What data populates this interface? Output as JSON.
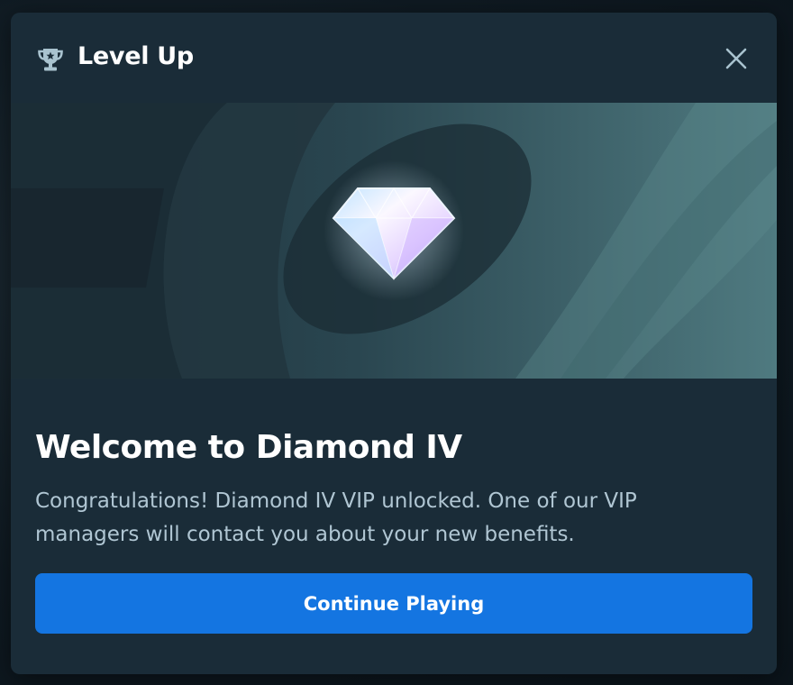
{
  "modal": {
    "title": "Level Up",
    "heading": "Welcome to Diamond IV",
    "message": "Congratulations! Diamond IV VIP unlocked. One of our VIP managers will contact you about your new benefits.",
    "cta_label": "Continue Playing"
  },
  "icons": {
    "header": "trophy-icon",
    "close": "close-icon",
    "banner": "diamond-icon"
  },
  "colors": {
    "modal_bg": "#1a2c38",
    "button_bg": "#1475e1",
    "heading_text": "#ffffff",
    "body_text": "#b0c6d3",
    "icon_color": "#a9c3cf"
  }
}
